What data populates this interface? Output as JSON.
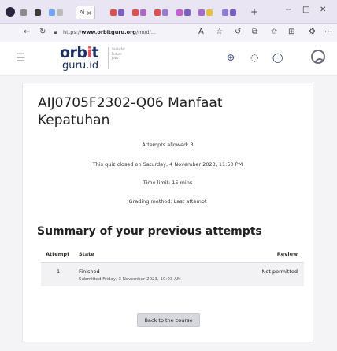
{
  "browser": {
    "active_tab_label": "Ai",
    "url_prefix": "https://",
    "url_domain": "www.orbitguru.org",
    "url_suffix": "/mod/...",
    "new_tab_glyph": "+"
  },
  "site": {
    "logo_top": "orbit",
    "logo_bottom": "guru.id",
    "tagline": "Skills for Future Jobs"
  },
  "quiz": {
    "title": "AIJ0705F2302-Q06 Manfaat Kepatuhan",
    "attempts_allowed": "Attempts allowed: 3",
    "closed_on": "This quiz closed on Saturday, 4 November 2023, 11:50 PM",
    "time_limit": "Time limit: 15 mins",
    "grading_method": "Grading method: Last attempt"
  },
  "summary": {
    "heading": "Summary of your previous attempts",
    "columns": [
      "Attempt",
      "State",
      "Review"
    ],
    "rows": [
      {
        "attempt": "1",
        "state": "Finished",
        "submitted": "Submitted Friday, 3 November 2023, 10:03 AM",
        "review": "Not permitted"
      }
    ]
  },
  "back_button": "Back to the course",
  "colors": {
    "brand_navy": "#1b2f67",
    "brand_red": "#ef4a5a",
    "tab_strip": "#e9e5f3"
  }
}
